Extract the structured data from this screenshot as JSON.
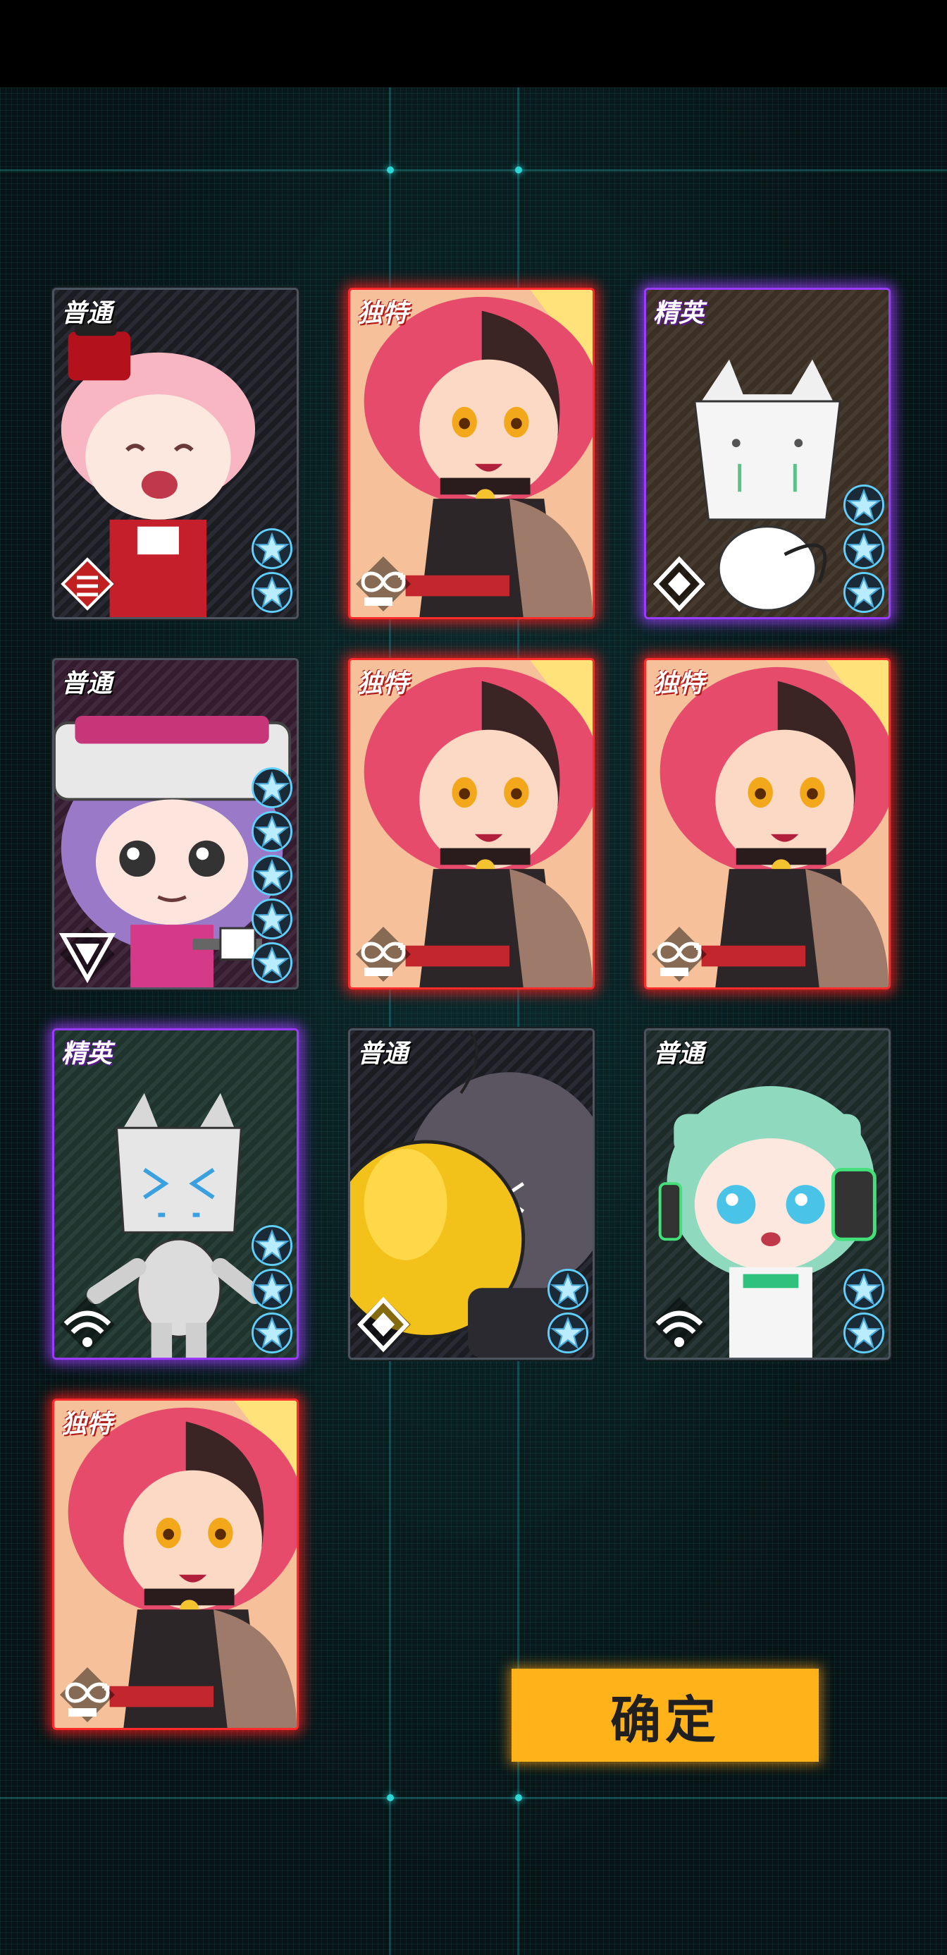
{
  "confirm_label": "确定",
  "colors": {
    "normal": "#4a5560",
    "elite": "#9a3cff",
    "unique": "#ff2a2a",
    "star": "#8fe3ff",
    "button": "#ffb21a"
  },
  "cards": [
    {
      "tier": "普通",
      "stars": 2,
      "class_icon": "striped-diamond-icon",
      "character": "pink-hair-maid-chibi"
    },
    {
      "tier": "独特",
      "stars": 0,
      "class_icon": "infinity-plus-icon",
      "character": "red-haired-girl-portrait"
    },
    {
      "tier": "精英",
      "stars": 3,
      "class_icon": "diamond-icon",
      "character": "white-box-cat-robot"
    },
    {
      "tier": "普通",
      "stars": 5,
      "class_icon": "triangle-icon",
      "character": "purple-hair-helmet-chibi"
    },
    {
      "tier": "独特",
      "stars": 0,
      "class_icon": "infinity-plus-icon",
      "character": "red-haired-girl-portrait"
    },
    {
      "tier": "独特",
      "stars": 0,
      "class_icon": "infinity-plus-icon",
      "character": "red-haired-girl-portrait"
    },
    {
      "tier": "精英",
      "stars": 3,
      "class_icon": "signal-icon",
      "character": "grey-box-cat-robot"
    },
    {
      "tier": "普通",
      "stars": 2,
      "class_icon": "diamond-icon",
      "character": "yellow-ball-mech"
    },
    {
      "tier": "普通",
      "stars": 2,
      "class_icon": "signal-icon",
      "character": "green-hair-headphone-chibi"
    },
    {
      "tier": "独特",
      "stars": 0,
      "class_icon": "infinity-plus-icon",
      "character": "red-haired-girl-portrait"
    }
  ]
}
